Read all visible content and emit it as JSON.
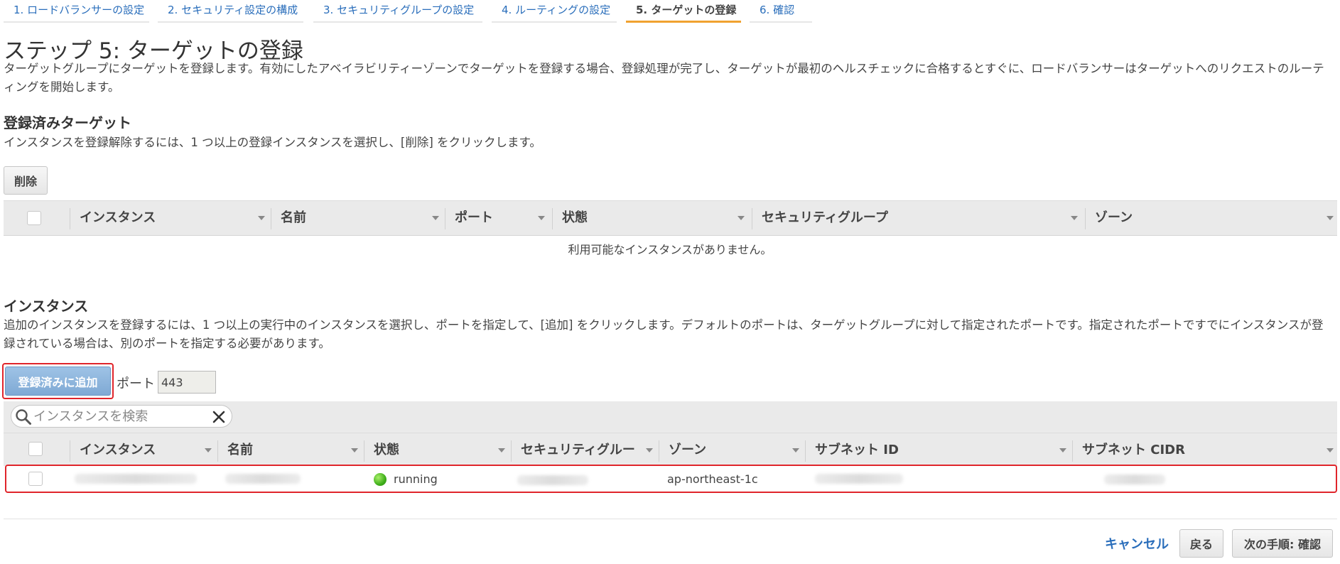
{
  "wizard": {
    "steps": [
      {
        "label": "1. ロードバランサーの設定"
      },
      {
        "label": "2. セキュリティ設定の構成"
      },
      {
        "label": "3. セキュリティグループの設定"
      },
      {
        "label": "4. ルーティングの設定"
      },
      {
        "label": "5. ターゲットの登録"
      },
      {
        "label": "6. 確認"
      }
    ],
    "active_index": 4
  },
  "page": {
    "title": "ステップ 5: ターゲットの登録",
    "description": "ターゲットグループにターゲットを登録します。有効にしたアベイラビリティーゾーンでターゲットを登録する場合、登録処理が完了し、ターゲットが最初のヘルスチェックに合格するとすぐに、ロードバランサーはターゲットへのリクエストのルーティングを開始します。"
  },
  "registered": {
    "title": "登録済みターゲット",
    "description": "インスタンスを登録解除するには、1 つ以上の登録インスタンスを選択し、[削除] をクリックします。",
    "remove_label": "削除",
    "columns": [
      "インスタンス",
      "名前",
      "ポート",
      "状態",
      "セキュリティグループ",
      "ゾーン"
    ],
    "empty_message": "利用可能なインスタンスがありません。"
  },
  "instances": {
    "title": "インスタンス",
    "description": "追加のインスタンスを登録するには、1 つ以上の実行中のインスタンスを選択し、ポートを指定して、[追加] をクリックします。デフォルトのポートは、ターゲットグループに対して指定されたポートです。指定されたポートですでにインスタンスが登録されている場合は、別のポートを指定する必要があります。",
    "add_label": "登録済みに追加",
    "port_label": "ポート",
    "port_value": "443",
    "search_placeholder": "インスタンスを検索",
    "columns": [
      "インスタンス",
      "名前",
      "状態",
      "セキュリティグルー",
      "ゾーン",
      "サブネット ID",
      "サブネット CIDR"
    ],
    "rows": [
      {
        "status": "running",
        "zone": "ap-northeast-1c"
      }
    ]
  },
  "footer": {
    "cancel_label": "キャンセル",
    "back_label": "戻る",
    "next_label": "次の手順: 確認"
  },
  "colors": {
    "link": "#2a6ebb",
    "active_tab_underline": "#f0a230",
    "highlight_border": "#e0252b",
    "primary_button": "#8fb6de"
  }
}
